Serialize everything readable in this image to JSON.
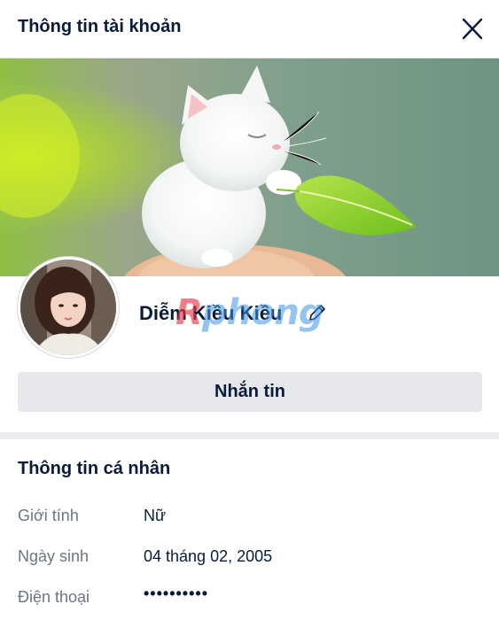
{
  "header": {
    "title": "Thông tin tài khoản",
    "close_icon": "close-icon"
  },
  "profile": {
    "cover_image": "white kitten holding green leaf",
    "avatar": "user-avatar-photo",
    "name": "Diễm Kiều Kiều",
    "edit_icon": "pencil-icon",
    "watermark": "Rphong"
  },
  "actions": {
    "message_label": "Nhắn tin"
  },
  "personal_info": {
    "title": "Thông tin cá nhân",
    "rows": [
      {
        "label": "Giới tính",
        "value": "Nữ"
      },
      {
        "label": "Ngày sinh",
        "value": "04 tháng 02, 2005"
      },
      {
        "label": "Điện thoại",
        "value": "••••••••••"
      }
    ]
  },
  "colors": {
    "text_primary": "#081b3a",
    "text_secondary": "#6b7684",
    "button_bg": "#e6e8eb",
    "divider": "#e9ebef"
  }
}
